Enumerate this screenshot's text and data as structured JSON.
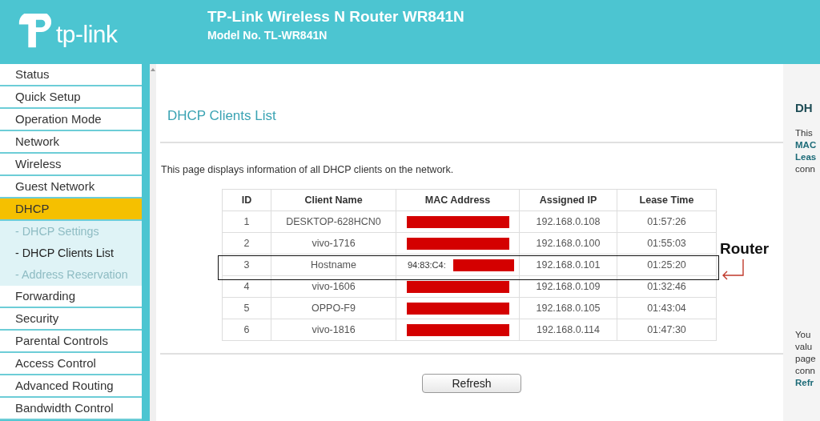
{
  "header": {
    "logo_text": "tp-link",
    "title": "TP-Link Wireless N Router WR841N",
    "model": "Model No. TL-WR841N"
  },
  "sidebar": {
    "items": [
      {
        "label": "Status",
        "selected": false
      },
      {
        "label": "Quick Setup",
        "selected": false
      },
      {
        "label": "Operation Mode",
        "selected": false
      },
      {
        "label": "Network",
        "selected": false
      },
      {
        "label": "Wireless",
        "selected": false
      },
      {
        "label": "Guest Network",
        "selected": false
      },
      {
        "label": "DHCP",
        "selected": true,
        "children": [
          {
            "label": "- DHCP Settings",
            "selected": false
          },
          {
            "label": "- DHCP Clients List",
            "selected": true
          },
          {
            "label": "- Address Reservation",
            "selected": false
          }
        ]
      },
      {
        "label": "Forwarding",
        "selected": false
      },
      {
        "label": "Security",
        "selected": false
      },
      {
        "label": "Parental Controls",
        "selected": false
      },
      {
        "label": "Access Control",
        "selected": false
      },
      {
        "label": "Advanced Routing",
        "selected": false
      },
      {
        "label": "Bandwidth Control",
        "selected": false
      }
    ]
  },
  "main": {
    "title": "DHCP Clients List",
    "description": "This page displays information of all DHCP clients on the network.",
    "table": {
      "columns": [
        "ID",
        "Client Name",
        "MAC Address",
        "Assigned IP",
        "Lease Time"
      ],
      "rows": [
        {
          "id": "1",
          "client_name": "DESKTOP-628HCN0",
          "redacted": true,
          "assigned_ip": "192.168.0.108",
          "lease_time": "01:57:26",
          "highlighted": false
        },
        {
          "id": "2",
          "client_name": "vivo-1716",
          "redacted": true,
          "assigned_ip": "192.168.0.100",
          "lease_time": "01:55:03",
          "highlighted": false
        },
        {
          "id": "3",
          "client_name": "Hostname",
          "mac_visible": "94:83:C4:",
          "redacted": true,
          "assigned_ip": "192.168.0.101",
          "lease_time": "01:25:20",
          "highlighted": true
        },
        {
          "id": "4",
          "client_name": "vivo-1606",
          "redacted": true,
          "assigned_ip": "192.168.0.109",
          "lease_time": "01:32:46",
          "highlighted": false
        },
        {
          "id": "5",
          "client_name": "OPPO-F9",
          "redacted": true,
          "assigned_ip": "192.168.0.105",
          "lease_time": "01:43:04",
          "highlighted": false
        },
        {
          "id": "6",
          "client_name": "vivo-1816",
          "redacted": true,
          "assigned_ip": "192.168.0.114",
          "lease_time": "01:47:30",
          "highlighted": false
        }
      ]
    },
    "annotation": {
      "label": "Router"
    },
    "refresh_button": "Refresh"
  },
  "help": {
    "title": "DH",
    "paragraphs": [
      {
        "lines": [
          {
            "text": "This",
            "kind": "plain"
          },
          {
            "text": "MAC",
            "kind": "term"
          },
          {
            "text": "Leas",
            "kind": "term"
          },
          {
            "text": "conn",
            "kind": "plain"
          }
        ]
      },
      {
        "lines": [
          {
            "text": "You",
            "kind": "plain"
          },
          {
            "text": "valu",
            "kind": "plain"
          },
          {
            "text": "page",
            "kind": "plain"
          },
          {
            "text": "conn",
            "kind": "plain"
          },
          {
            "text": "Refr",
            "kind": "term"
          }
        ]
      }
    ]
  }
}
